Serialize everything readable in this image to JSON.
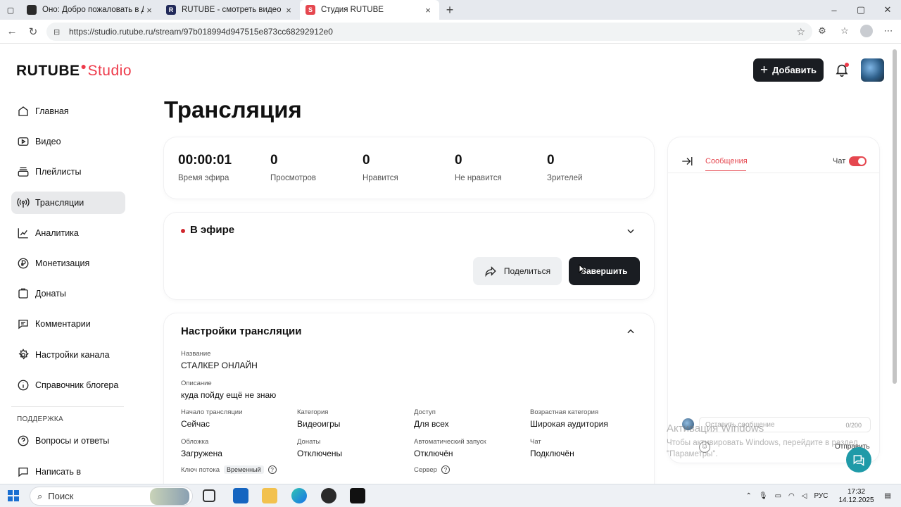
{
  "browser": {
    "tabs": [
      {
        "title": "Оно: Добро пожаловать в Дерр",
        "favicon_color": "#2b2b2b"
      },
      {
        "title": "RUTUBE - смотреть видео онлай",
        "favicon_color": "#222a5a",
        "favicon_letter": "R"
      },
      {
        "title": "Студия RUTUBE",
        "favicon_color": "#e5474f",
        "favicon_letter": "S"
      }
    ],
    "url": "https://studio.rutube.ru/stream/97b018994d947515e873cc68292912e0"
  },
  "header": {
    "logo_main": "RUTUBE",
    "logo_sub": "Studio",
    "add_label": "Добавить"
  },
  "sidebar": {
    "items": [
      {
        "label": "Главная",
        "icon": "home-icon"
      },
      {
        "label": "Видео",
        "icon": "video-icon"
      },
      {
        "label": "Плейлисты",
        "icon": "playlist-icon"
      },
      {
        "label": "Трансляции",
        "icon": "broadcast-icon",
        "active": true
      },
      {
        "label": "Аналитика",
        "icon": "analytics-icon"
      },
      {
        "label": "Монетизация",
        "icon": "monetization-icon"
      },
      {
        "label": "Донаты",
        "icon": "donate-icon"
      },
      {
        "label": "Комментарии",
        "icon": "comments-icon"
      },
      {
        "label": "Настройки канала",
        "icon": "gear-icon"
      },
      {
        "label": "Справочник блогера",
        "icon": "info-icon"
      }
    ],
    "support_title": "ПОДДЕРЖКА",
    "support_items": [
      {
        "label": "Вопросы и ответы",
        "icon": "question-icon"
      },
      {
        "label": "Написать в",
        "icon": "chat-icon"
      }
    ]
  },
  "main": {
    "title": "Трансляция",
    "stats": [
      {
        "value": "00:00:01",
        "label": "Время эфира"
      },
      {
        "value": "0",
        "label": "Просмотров"
      },
      {
        "value": "0",
        "label": "Нравится"
      },
      {
        "value": "0",
        "label": "Не нравится"
      },
      {
        "value": "0",
        "label": "Зрителей"
      }
    ],
    "live": {
      "status": "В эфире",
      "share_label": "Поделиться",
      "finish_label": "Завершить",
      "status_color": "#d0272e"
    },
    "settings": {
      "title": "Настройки трансляции",
      "name_label": "Название",
      "name_value": "СТАЛКЕР ОНЛАЙН",
      "desc_label": "Описание",
      "desc_value": "куда пойду ещё не знаю",
      "grid": [
        {
          "label": "Начало трансляции",
          "value": "Сейчас"
        },
        {
          "label": "Категория",
          "value": "Видеоигры"
        },
        {
          "label": "Доступ",
          "value": "Для всех"
        },
        {
          "label": "Возрастная категория",
          "value": "Широкая аудитория"
        },
        {
          "label": "Обложка",
          "value": "Загружена"
        },
        {
          "label": "Донаты",
          "value": "Отключены"
        },
        {
          "label": "Автоматический запуск",
          "value": "Отключён"
        },
        {
          "label": "Чат",
          "value": "Подключён"
        }
      ],
      "stream_key_label": "Ключ потока",
      "stream_key_tag": "Временный",
      "server_label": "Сервер"
    }
  },
  "chat": {
    "tab_label": "Сообщения",
    "chat_label": "Чат",
    "chat_enabled": true,
    "input_placeholder": "Оставить сообщение",
    "counter": "0/200",
    "send_label": "Отправить",
    "accent": "#e5474f"
  },
  "watermark": {
    "line1": "Активация Windows",
    "line2": "Чтобы активировать Windows, перейдите в раздел \"Параметры\"."
  },
  "taskbar": {
    "search_label": "Поиск",
    "lang": "РУС",
    "time": "17:32",
    "date": "14.12.2025"
  }
}
